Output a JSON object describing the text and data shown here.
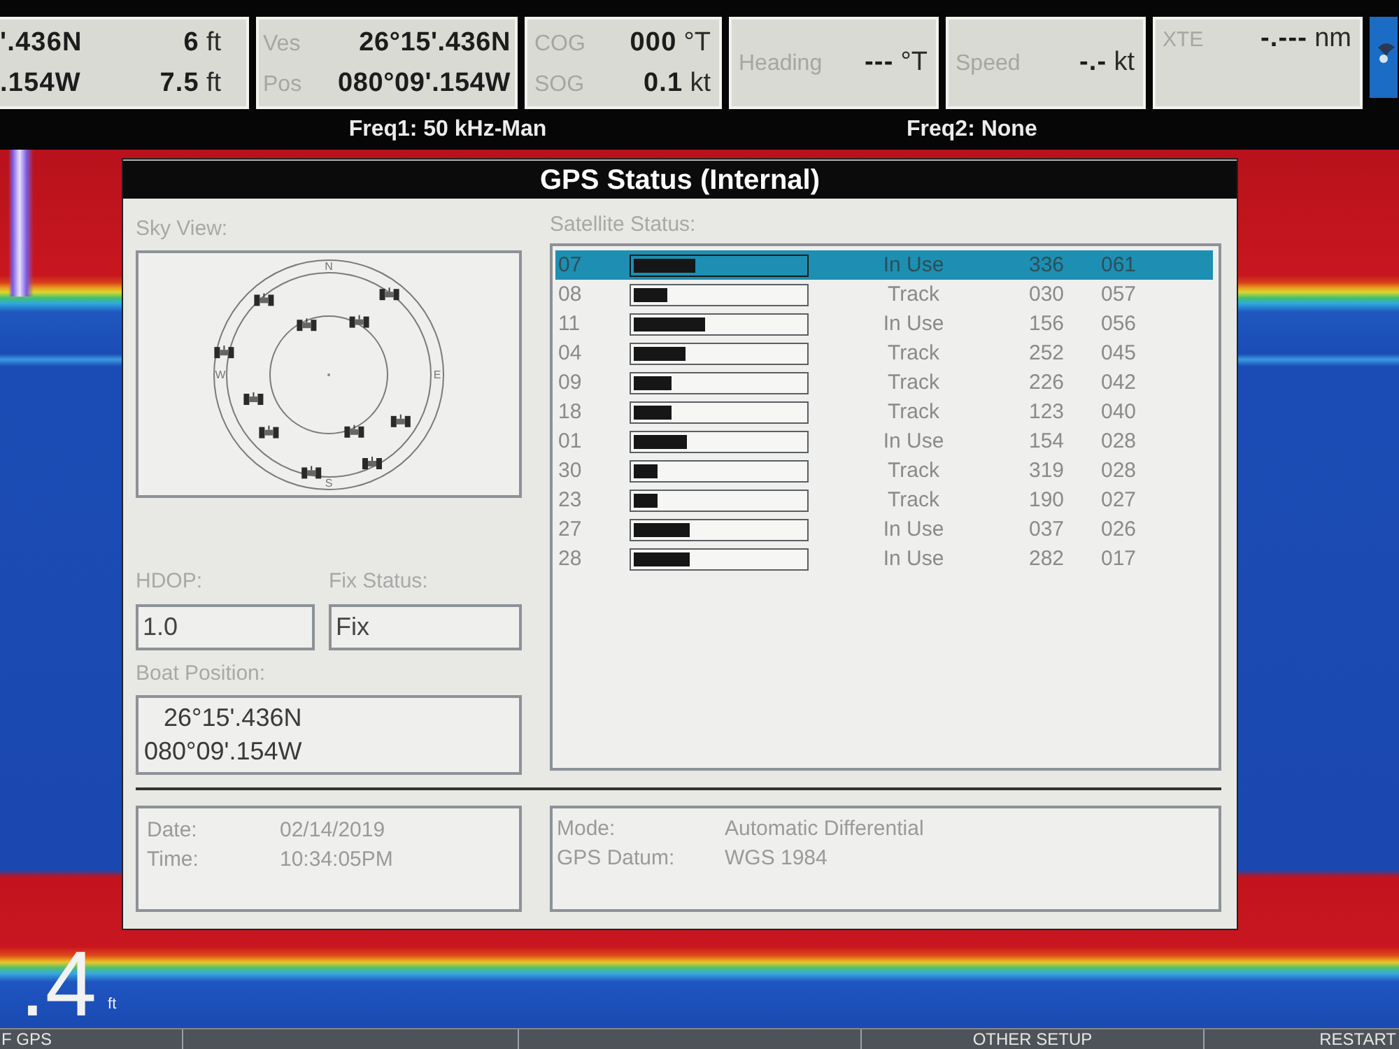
{
  "top_bar": {
    "data_boxes": [
      {
        "kind": "rows",
        "rows": [
          {
            "value": "'.436N",
            "reading": "6",
            "unit": "ft"
          },
          {
            "value": ".154W",
            "reading": "7.5",
            "unit": "ft"
          }
        ]
      },
      {
        "kind": "rows",
        "rows": [
          {
            "label": "Ves",
            "value": "26°15'.436N"
          },
          {
            "label": "Pos",
            "value": "080°09'.154W"
          }
        ]
      },
      {
        "kind": "rows",
        "rows": [
          {
            "label": "COG",
            "reading": "000",
            "unit": "°T"
          },
          {
            "label": "SOG",
            "reading": "0.1",
            "unit": "kt"
          }
        ]
      },
      {
        "kind": "single",
        "rows": [
          {
            "label": "Heading",
            "reading": "---",
            "unit": "°T"
          }
        ]
      },
      {
        "kind": "single",
        "rows": [
          {
            "label": "Speed",
            "reading": "-.-",
            "unit": "kt"
          }
        ]
      },
      {
        "kind": "top",
        "rows": [
          {
            "label": "XTE",
            "reading": "-.---",
            "unit": "nm"
          }
        ]
      }
    ],
    "frequencies": [
      "Freq1: 50 kHz-Man",
      "Freq2: None"
    ]
  },
  "dialog": {
    "title": "GPS Status (Internal)",
    "sky_view": {
      "label": "Sky View:",
      "compass": [
        "N",
        "E",
        "S",
        "W"
      ]
    },
    "satellite_status": {
      "label": "Satellite Status:",
      "satellites": [
        {
          "prn": "07",
          "level": 0.36,
          "status": "In Use",
          "azimuth": "336",
          "elevation": "061",
          "selected": true
        },
        {
          "prn": "08",
          "level": 0.2,
          "status": "Track",
          "azimuth": "030",
          "elevation": "057",
          "selected": false
        },
        {
          "prn": "11",
          "level": 0.42,
          "status": "In Use",
          "azimuth": "156",
          "elevation": "056",
          "selected": false
        },
        {
          "prn": "04",
          "level": 0.3,
          "status": "Track",
          "azimuth": "252",
          "elevation": "045",
          "selected": false
        },
        {
          "prn": "09",
          "level": 0.22,
          "status": "Track",
          "azimuth": "226",
          "elevation": "042",
          "selected": false
        },
        {
          "prn": "18",
          "level": 0.22,
          "status": "Track",
          "azimuth": "123",
          "elevation": "040",
          "selected": false
        },
        {
          "prn": "01",
          "level": 0.31,
          "status": "In Use",
          "azimuth": "154",
          "elevation": "028",
          "selected": false
        },
        {
          "prn": "30",
          "level": 0.14,
          "status": "Track",
          "azimuth": "319",
          "elevation": "028",
          "selected": false
        },
        {
          "prn": "23",
          "level": 0.14,
          "status": "Track",
          "azimuth": "190",
          "elevation": "027",
          "selected": false
        },
        {
          "prn": "27",
          "level": 0.33,
          "status": "In Use",
          "azimuth": "037",
          "elevation": "026",
          "selected": false
        },
        {
          "prn": "28",
          "level": 0.33,
          "status": "In Use",
          "azimuth": "282",
          "elevation": "017",
          "selected": false
        }
      ]
    },
    "hdop": {
      "label": "HDOP:",
      "value": "1.0"
    },
    "fix_status": {
      "label": "Fix Status:",
      "value": "Fix"
    },
    "boat_position": {
      "label": "Boat Position:",
      "lines": [
        "26°15'.436N",
        "080°09'.154W"
      ]
    },
    "date_time": [
      {
        "label": "Date:",
        "value": "02/14/2019"
      },
      {
        "label": "Time:",
        "value": "10:34:05PM"
      }
    ],
    "receiver": [
      {
        "label": "Mode:",
        "value": "Automatic Differential"
      },
      {
        "label": "GPS Datum:",
        "value": "WGS 1984"
      }
    ]
  },
  "depth": {
    "value": ".4",
    "unit": "ft"
  },
  "menu_bar": [
    {
      "kind": "tab",
      "label": "F GPS"
    },
    {
      "kind": "blank"
    },
    {
      "kind": "blank"
    },
    {
      "kind": "tab",
      "label": "OTHER SETUP"
    },
    {
      "kind": "tab",
      "label": "RESTART"
    }
  ]
}
